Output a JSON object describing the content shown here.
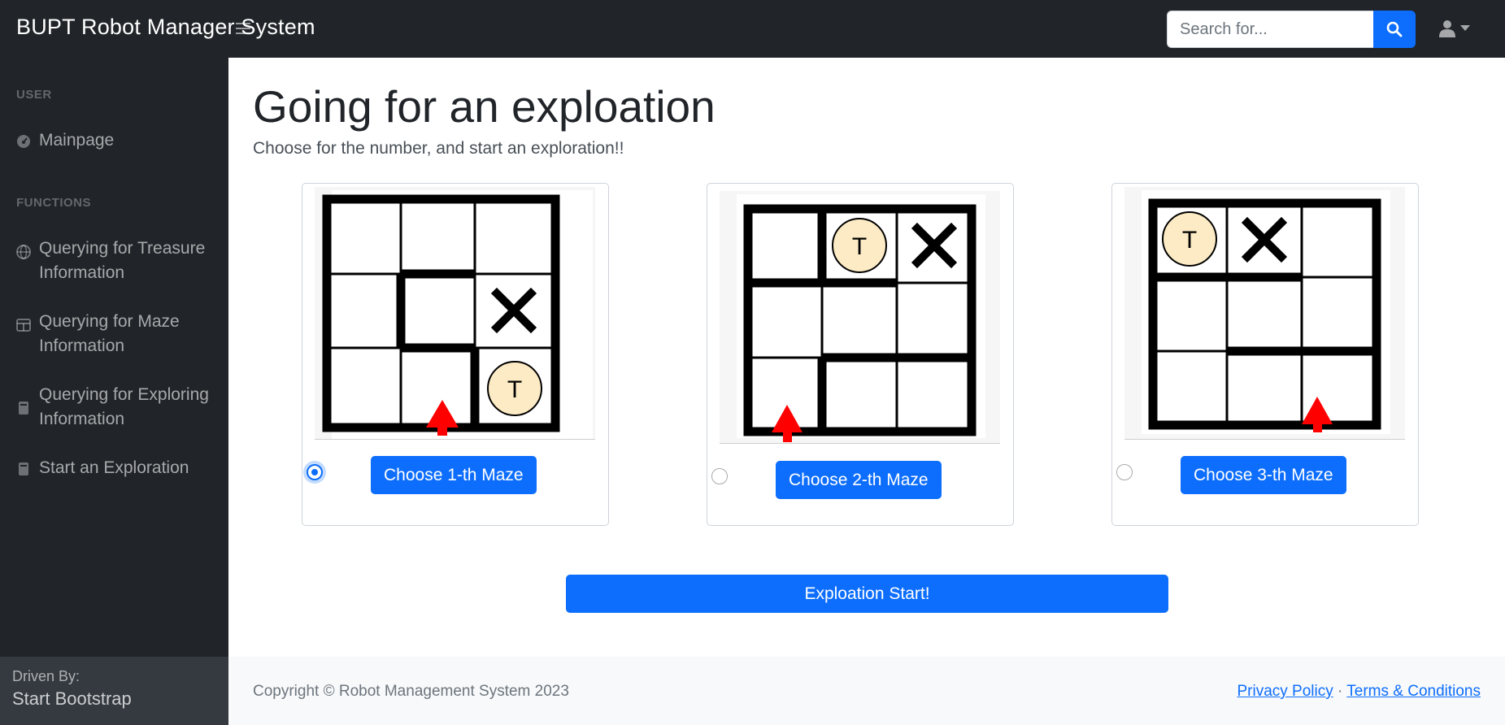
{
  "app": {
    "brand": "BUPT Robot Manager System"
  },
  "search": {
    "placeholder": "Search for..."
  },
  "sidebar": {
    "heading_user": "USER",
    "heading_functions": "FUNCTIONS",
    "items": [
      {
        "label": "Mainpage",
        "icon": "tachometer-icon"
      },
      {
        "label": "Querying for Treasure Information",
        "icon": "globe-icon"
      },
      {
        "label": "Querying for Maze Information",
        "icon": "table-icon"
      },
      {
        "label": "Querying for Exploring Information",
        "icon": "book-icon"
      },
      {
        "label": "Start an Exploration",
        "icon": "book-icon"
      }
    ],
    "footer_small": "Driven By:",
    "footer_big": "Start Bootstrap"
  },
  "main": {
    "title": "Going for an exploation",
    "subtitle": "Choose for the number, and start an exploration!!",
    "mazes": [
      {
        "label": "Choose 1-th Maze",
        "selected": true
      },
      {
        "label": "Choose 2-th Maze",
        "selected": false
      },
      {
        "label": "Choose 3-th Maze",
        "selected": false
      }
    ],
    "treasure_letter": "T",
    "start_label": "Exploation Start!"
  },
  "footer": {
    "copyright": "Copyright © Robot Management System 2023",
    "privacy": "Privacy Policy",
    "separator": "·",
    "terms": "Terms & Conditions"
  },
  "colors": {
    "accent": "#0d6efd",
    "nav": "#212529",
    "treasure": "#fcebc4",
    "arrow": "#ff0000"
  }
}
